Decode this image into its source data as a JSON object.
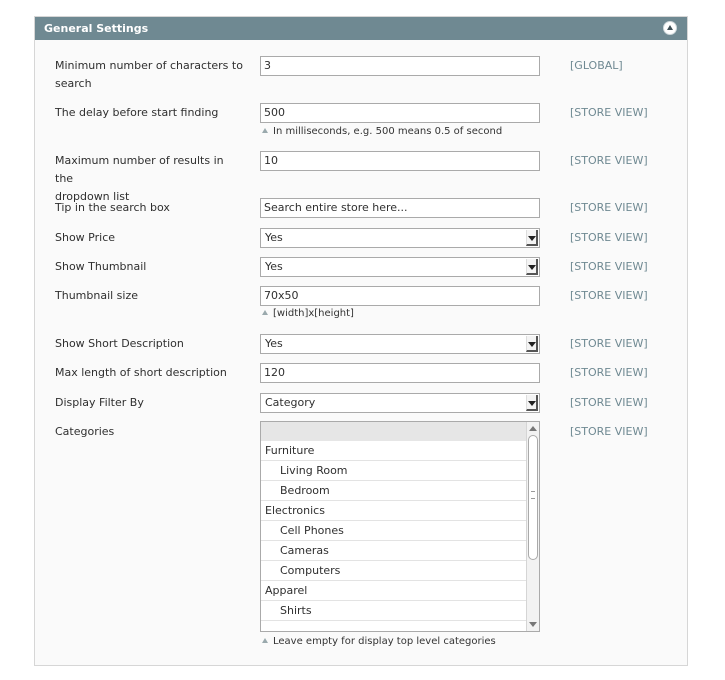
{
  "panel": {
    "title": "General Settings"
  },
  "rows": {
    "min_chars": {
      "label_line1": "Minimum number of characters to",
      "label_line2": "search",
      "value": "3",
      "scope": "[GLOBAL]"
    },
    "delay": {
      "label": "The delay before start finding",
      "value": "500",
      "note": "In milliseconds, e.g. 500 means 0.5 of second",
      "scope": "[STORE VIEW]"
    },
    "max_results": {
      "label_line1": "Maximum number of results in the",
      "label_line2": "dropdown list",
      "value": "10",
      "scope": "[STORE VIEW]"
    },
    "tip": {
      "label": "Tip in the search box",
      "value": "Search entire store here...",
      "scope": "[STORE VIEW]"
    },
    "show_price": {
      "label": "Show Price",
      "value": "Yes",
      "scope": "[STORE VIEW]"
    },
    "show_thumbnail": {
      "label": "Show Thumbnail",
      "value": "Yes",
      "scope": "[STORE VIEW]"
    },
    "thumbnail_size": {
      "label": "Thumbnail size",
      "value": "70x50",
      "note": "[width]x[height]",
      "scope": "[STORE VIEW]"
    },
    "show_short_desc": {
      "label": "Show Short Description",
      "value": "Yes",
      "scope": "[STORE VIEW]"
    },
    "max_short_desc": {
      "label": "Max length of short description",
      "value": "120",
      "scope": "[STORE VIEW]"
    },
    "filter_by": {
      "label": "Display Filter By",
      "value": "Category",
      "scope": "[STORE VIEW]"
    },
    "categories": {
      "label": "Categories",
      "scope": "[STORE VIEW]",
      "note": "Leave empty for display top level categories",
      "options": [
        "Furniture",
        "Living Room",
        "Bedroom",
        "Electronics",
        "Cell Phones",
        "Cameras",
        "Computers",
        "Apparel",
        "Shirts"
      ]
    }
  }
}
